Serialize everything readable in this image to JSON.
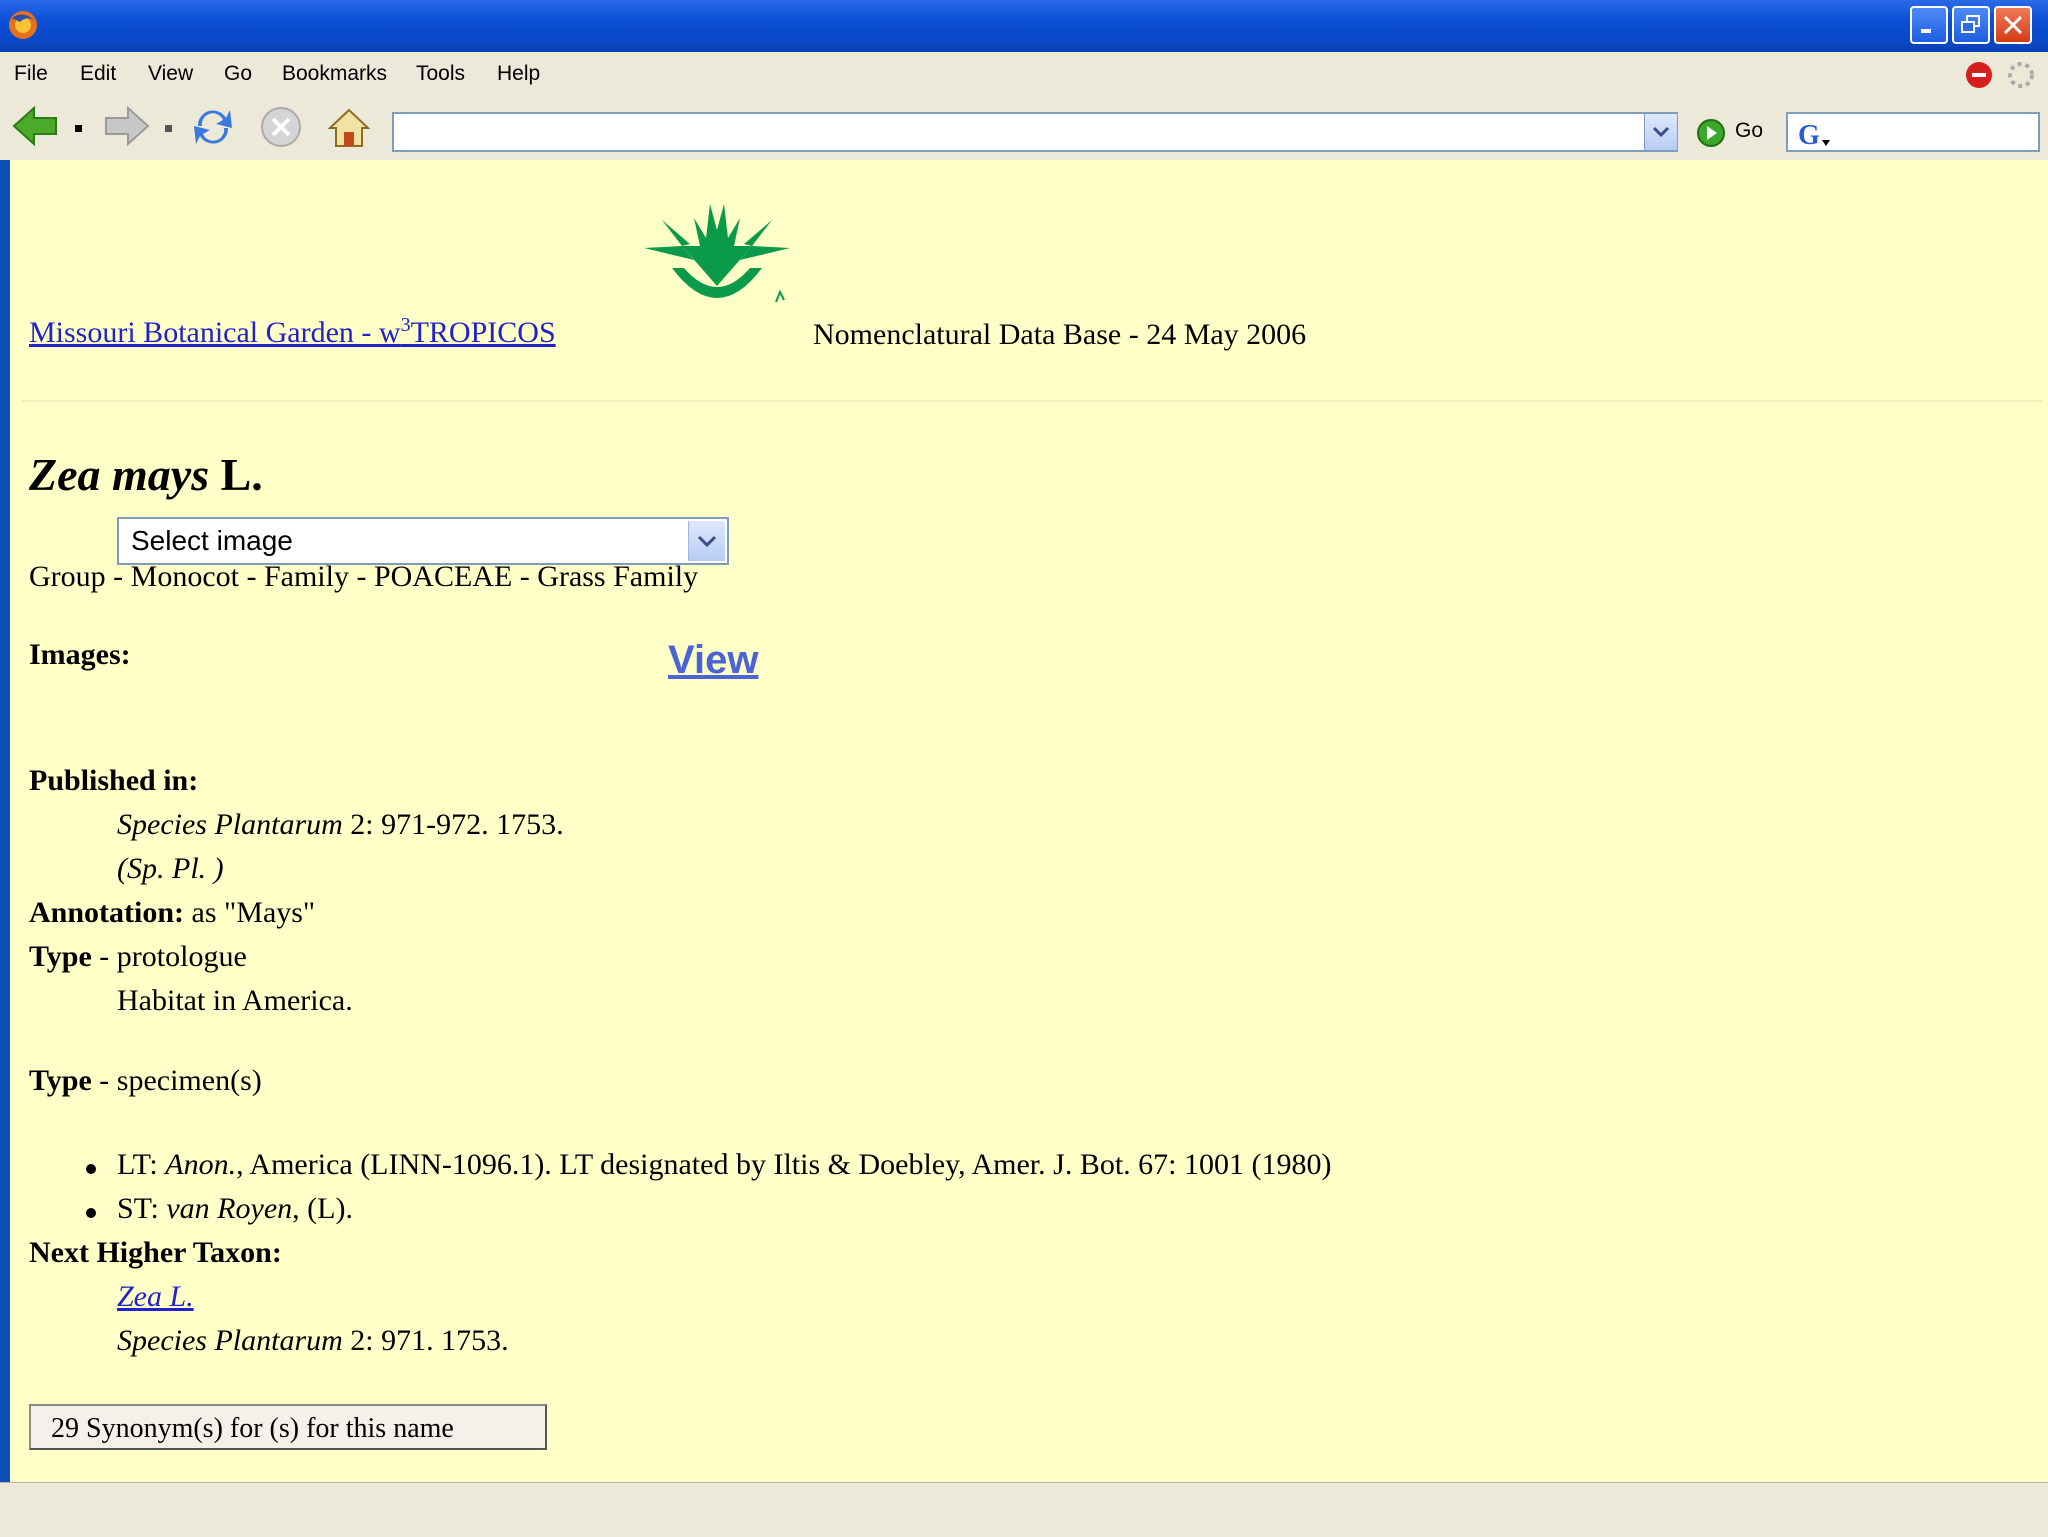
{
  "menu": {
    "file": "File",
    "edit": "Edit",
    "view": "View",
    "go": "Go",
    "bookmarks": "Bookmarks",
    "tools": "Tools",
    "help": "Help"
  },
  "toolbar": {
    "url": "",
    "go_label": "Go",
    "search_value": ""
  },
  "header": {
    "site_link": "Missouri Botanical Garden - w",
    "site_link_sup": "3",
    "site_link_tail": "TROPICOS",
    "db_title": "Nomenclatural Data Base - 24 May 2006"
  },
  "taxon": {
    "genus_species": "Zea mays",
    "author": "L.",
    "group_line": "Group - Monocot - Family - POACEAE - Grass Family"
  },
  "images": {
    "label": "Images:",
    "select_value": "Select image"
  },
  "published": {
    "label": "Published in:",
    "work": "Species Plantarum",
    "citation": " 2: 971-972. 1753.",
    "view_link": "View",
    "abbrev": "(Sp. Pl. )"
  },
  "annotation": {
    "label": "Annotation:",
    "value": " as \"Mays\""
  },
  "type_protologue": {
    "label": "Type",
    "value": " - protologue",
    "habitat": "Habitat in America."
  },
  "type_specimen": {
    "label": "Type",
    "value": " - specimen(s)",
    "items": [
      {
        "prefix": "LT: ",
        "italic": "Anon.",
        "rest": ", America (LINN-1096.1). LT designated by Iltis & Doebley, Amer. J. Bot. 67: 1001 (1980)"
      },
      {
        "prefix": "ST: ",
        "italic": "van Royen",
        "rest": ", (L)."
      }
    ]
  },
  "higher_taxon": {
    "label": "Next Higher Taxon:",
    "link": "Zea L.",
    "work": "Species Plantarum",
    "citation": " 2: 971. 1753."
  },
  "synonym_button": "29 Synonym(s) for (s) for this name"
}
